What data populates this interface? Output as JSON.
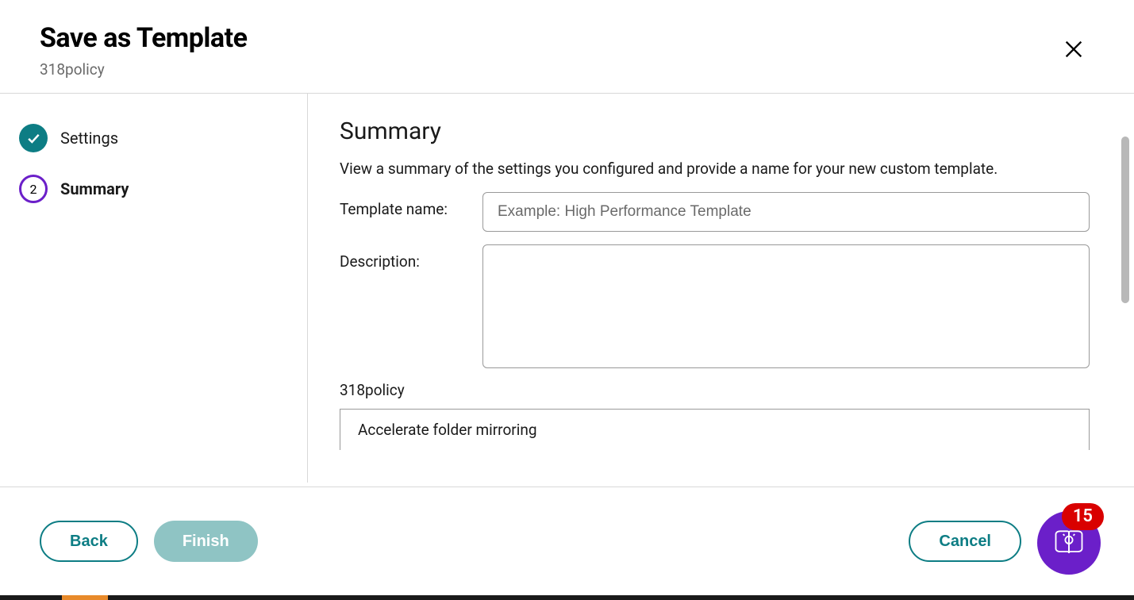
{
  "header": {
    "title": "Save as Template",
    "subtitle": "318policy"
  },
  "sidebar": {
    "steps": [
      {
        "label": "Settings",
        "state": "done"
      },
      {
        "label": "Summary",
        "state": "current",
        "number": "2"
      }
    ]
  },
  "main": {
    "title": "Summary",
    "description": "View a summary of the settings you configured and provide a name for your new custom template.",
    "templateNameLabel": "Template name:",
    "templateNamePlaceholder": "Example: High Performance Template",
    "templateNameValue": "",
    "descriptionLabel": "Description:",
    "descriptionValue": "",
    "policyName": "318policy",
    "policyItems": [
      "Accelerate folder mirroring"
    ]
  },
  "footer": {
    "backLabel": "Back",
    "finishLabel": "Finish",
    "cancelLabel": "Cancel",
    "helpBadgeCount": "15"
  }
}
